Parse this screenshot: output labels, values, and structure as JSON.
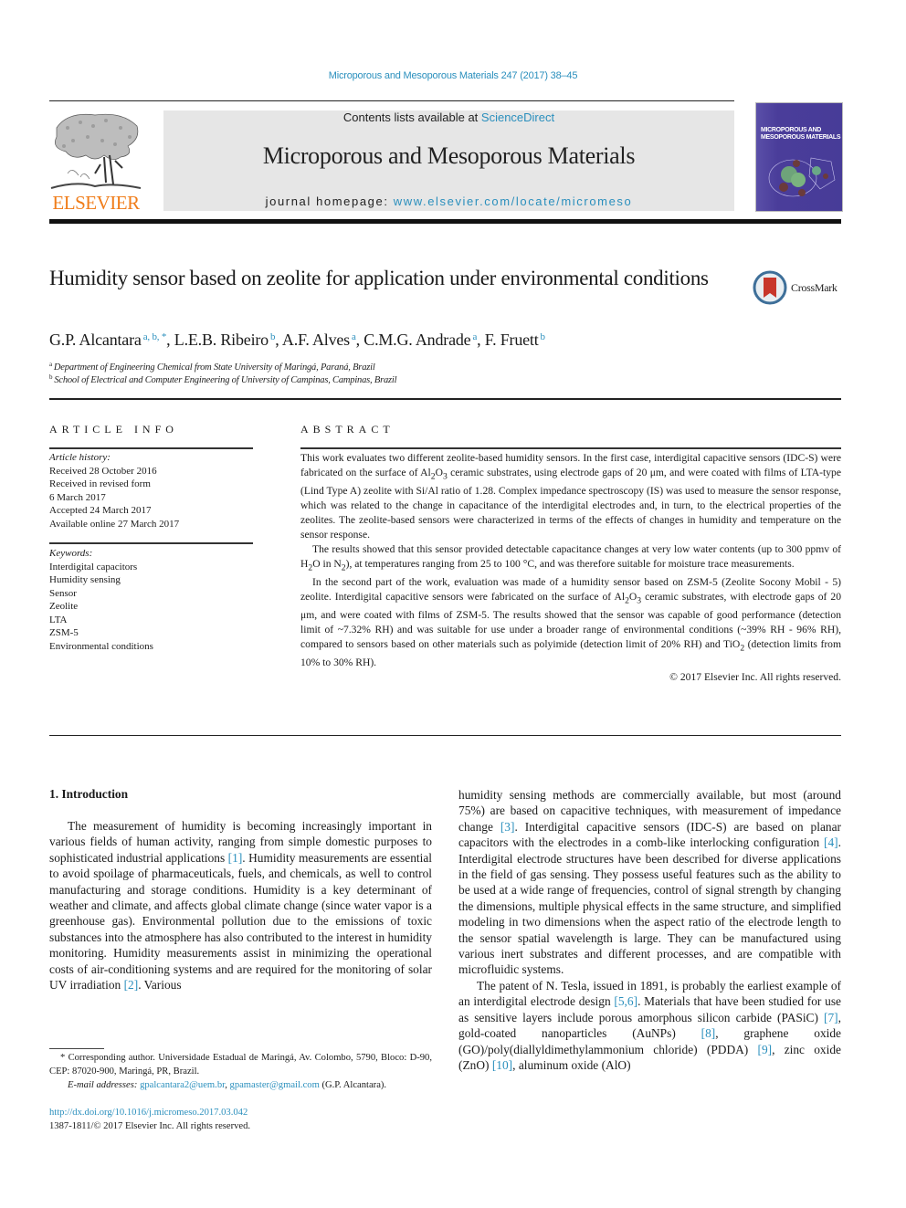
{
  "journal": {
    "running_head": "Microporous and Mesoporous Materials 247 (2017) 38–45",
    "contents_prefix": "Contents lists available at ",
    "contents_link": "ScienceDirect",
    "name": "Microporous and Mesoporous Materials",
    "homepage_prefix": "journal homepage: ",
    "homepage_link": "www.elsevier.com/locate/micromeso",
    "publisher_logo_text": "ELSEVIER",
    "cover_title_line1": "MICROPOROUS AND",
    "cover_title_line2": "MESOPOROUS MATERIALS",
    "crossmark_label": "CrossMark",
    "colors": {
      "link": "#2a8fbd",
      "elsevier_orange": "#f07d1a",
      "cover_purple": "#473c98",
      "masthead_gray": "#e6e6e6"
    }
  },
  "article": {
    "title": "Humidity sensor based on zeolite for application under environmental conditions",
    "authors": [
      {
        "name": "G.P. Alcantara",
        "sup": "a, b, *"
      },
      {
        "name": "L.E.B. Ribeiro",
        "sup": "b"
      },
      {
        "name": "A.F. Alves",
        "sup": "a"
      },
      {
        "name": "C.M.G. Andrade",
        "sup": "a"
      },
      {
        "name": "F. Fruett",
        "sup": "b"
      }
    ],
    "affiliations": [
      {
        "mark": "a",
        "text": "Department of Engineering Chemical from State University of Maringá, Paraná, Brazil"
      },
      {
        "mark": "b",
        "text": "School of Electrical and Computer Engineering of University of Campinas, Campinas, Brazil"
      }
    ]
  },
  "article_info": {
    "heading": "ARTICLE INFO",
    "history_label": "Article history:",
    "history": [
      "Received 28 October 2016",
      "Received in revised form",
      "6 March 2017",
      "Accepted 24 March 2017",
      "Available online 27 March 2017"
    ],
    "keywords_label": "Keywords:",
    "keywords": [
      "Interdigital capacitors",
      "Humidity sensing",
      "Sensor",
      "Zeolite",
      "LTA",
      "ZSM-5",
      "Environmental conditions"
    ]
  },
  "abstract": {
    "heading": "ABSTRACT",
    "p1_a": "This work evaluates two different zeolite-based humidity sensors. In the first case, interdigital capacitive sensors (IDC-S) were fabricated on the surface of Al",
    "p1_b": "O",
    "p1_c": " ceramic substrates, using electrode gaps of 20 μm, and were coated with films of LTA-type (Lind Type A) zeolite with Si/Al ratio of 1.28. Complex impedance spectroscopy (IS) was used to measure the sensor response, which was related to the change in capacitance of the interdigital electrodes and, in turn, to the electrical properties of the zeolites. The zeolite-based sensors were characterized in terms of the effects of changes in humidity and temperature on the sensor response.",
    "p2_a": "The results showed that this sensor provided detectable capacitance changes at very low water contents (up to 300 ppmv of H",
    "p2_b": "O in N",
    "p2_c": "), at temperatures ranging from 25 to 100 °C, and was therefore suitable for moisture trace measurements.",
    "p3_a": "In the second part of the work, evaluation was made of a humidity sensor based on ZSM-5 (Zeolite Socony Mobil - 5) zeolite. Interdigital capacitive sensors were fabricated on the surface of Al",
    "p3_b": "O",
    "p3_c": " ceramic substrates, with electrode gaps of 20 μm, and were coated with films of ZSM-5. The results showed that the sensor was capable of good performance (detection limit of ~7.32% RH) and was suitable for use under a broader range of environmental conditions (~39% RH - 96% RH), compared to sensors based on other materials such as polyimide (detection limit of 20% RH) and TiO",
    "p3_d": " (detection limits from 10% to 30% RH).",
    "sub2": "2",
    "sub3": "3",
    "copyright": "© 2017 Elsevier Inc. All rights reserved."
  },
  "intro": {
    "heading": "1.  Introduction",
    "left_p1_a": "The measurement of humidity is becoming increasingly important in various fields of human activity, ranging from simple domestic purposes to sophisticated industrial applications ",
    "ref1": "[1]",
    "left_p1_b": ". Humidity measurements are essential to avoid spoilage of pharmaceuticals, fuels, and chemicals, as well to control manufacturing and storage conditions. Humidity is a key determinant of weather and climate, and affects global climate change (since water vapor is a greenhouse gas). Environmental pollution due to the emissions of toxic substances into the atmosphere has also contributed to the interest in humidity monitoring. Humidity measurements assist in minimizing the operational costs of air-conditioning systems and are required for the monitoring of solar UV irradiation ",
    "ref2": "[2]",
    "left_p1_c": ". Various",
    "right_p1_a": "humidity sensing methods are commercially available, but most (around 75%) are based on capacitive techniques, with measurement of impedance change ",
    "ref3": "[3]",
    "right_p1_b": ". Interdigital capacitive sensors (IDC-S) are based on planar capacitors with the electrodes in a comb-like interlocking configuration ",
    "ref4": "[4]",
    "right_p1_c": ". Interdigital electrode structures have been described for diverse applications in the field of gas sensing. They possess useful features such as the ability to be used at a wide range of frequencies, control of signal strength by changing the dimensions, multiple physical effects in the same structure, and simplified modeling in two dimensions when the aspect ratio of the electrode length to the sensor spatial wavelength is large. They can be manufactured using various inert substrates and different processes, and are compatible with microfluidic systems.",
    "right_p2_a": "The patent of N. Tesla, issued in 1891, is probably the earliest example of an interdigital electrode design ",
    "ref56": "[5,6]",
    "right_p2_b": ". Materials that have been studied for use as sensitive layers include porous amorphous silicon carbide (PASiC) ",
    "ref7": "[7]",
    "right_p2_c": ", gold-coated nanoparticles (AuNPs) ",
    "ref8": "[8]",
    "right_p2_d": ", graphene oxide (GO)/poly(diallyldimethylammonium chloride) (PDDA) ",
    "ref9": "[9]",
    "right_p2_e": ", zinc oxide (ZnO) ",
    "ref10": "[10]",
    "right_p2_f": ", aluminum oxide (AlO)"
  },
  "footnotes": {
    "corresponding": "* Corresponding author. Universidade Estadual de Maringá, Av. Colombo, 5790, Bloco: D-90, CEP: 87020-900, Maringá, PR, Brazil.",
    "email_label": "E-mail addresses: ",
    "email1": "gpalcantara2@uem.br",
    "email_sep": ", ",
    "email2": "gpamaster@gmail.com",
    "email_owner": " (G.P. Alcantara).",
    "doi": "http://dx.doi.org/10.1016/j.micromeso.2017.03.042",
    "issn": "1387-1811/© 2017 Elsevier Inc. All rights reserved."
  }
}
